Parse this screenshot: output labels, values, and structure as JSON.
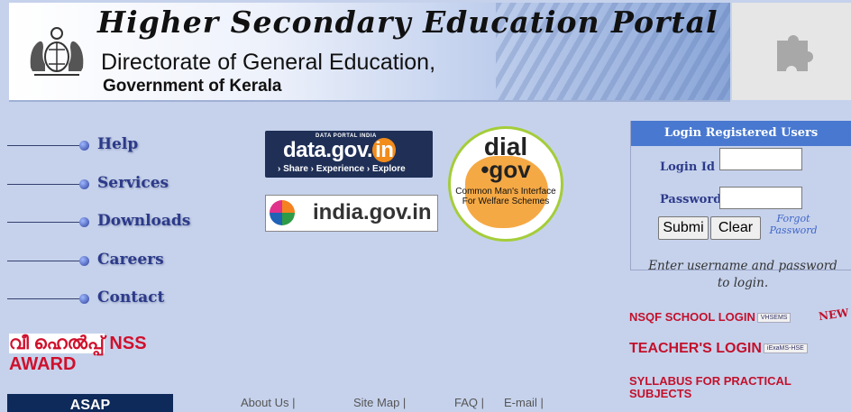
{
  "header": {
    "portal_title": "Higher Secondary Education Portal",
    "directorate": "Directorate of General Education,",
    "government": "Government of Kerala"
  },
  "nav": {
    "items": [
      {
        "label": "Help"
      },
      {
        "label": "Services"
      },
      {
        "label": "Downloads"
      },
      {
        "label": "Careers"
      },
      {
        "label": "Contact"
      }
    ]
  },
  "logos": {
    "datagov": {
      "tag": "DATA PORTAL INDIA",
      "name": "data.gov.",
      "tld": "in",
      "sub": "› Share  › Experience  › Explore"
    },
    "indiagov": {
      "name": "india.gov.in"
    },
    "dialgov": {
      "line1": "dial",
      "line2": "•gov",
      "caption": "Common Man's Interface For Welfare Schemes"
    }
  },
  "login": {
    "header": "Login Registered Users",
    "login_id_label": "Login Id",
    "login_id_value": "",
    "password_label": "Password",
    "password_value": "",
    "submit_label": "Submi",
    "clear_label": "Clear",
    "forgot_label": "Forgot Password",
    "hint": "Enter username and password to login."
  },
  "side_links": {
    "nsqf": {
      "label": "NSQF SCHOOL LOGIN",
      "badge": "VHSEMS"
    },
    "new_badge": "NEW",
    "teacher": {
      "label": "TEACHER'S LOGIN",
      "badge": "iExaMS-HSE"
    },
    "syllabus": "SYLLABUS FOR PRACTICAL SUBJECTS"
  },
  "nss": {
    "malayalam": "വീ ഹെൽപ്പ്",
    "nss_text": "NSS",
    "award": "AWARD"
  },
  "bottom": {
    "asap": "ASAP",
    "footer_links": [
      "About Us |",
      "Site Map |",
      "FAQ |",
      "E-mail |"
    ]
  },
  "colors": {
    "background": "#c6d2ec",
    "login_header": "#4878d0",
    "nav_text": "#2c3a8a",
    "link_red": "#c3102b"
  }
}
